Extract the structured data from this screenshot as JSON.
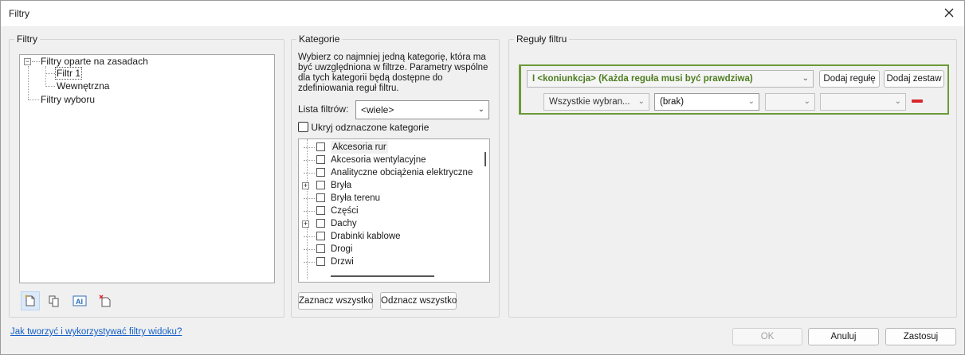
{
  "window": {
    "title": "Filtry"
  },
  "filters_group": {
    "title": "Filtry",
    "tree": {
      "root1": "Filtry oparte na zasadach",
      "child1": "Filtr 1",
      "child2": "Wewnętrzna",
      "root2": "Filtry wyboru"
    },
    "tools": [
      "new-filter-icon",
      "duplicate-filter-icon",
      "rename-filter-icon",
      "delete-filter-icon"
    ]
  },
  "category_group": {
    "title": "Kategorie",
    "description": "Wybierz co najmniej jedną kategorię, która ma być uwzględniona w filtrze. Parametry wspólne dla tych kategorii będą dostępne do zdefiniowania reguł filtru.",
    "filter_list_label": "Lista filtrów:",
    "filter_list_value": "<wiele>",
    "hide_unchecked_label": "Ukryj odznaczone kategorie",
    "categories": [
      {
        "label": "Akcesoria rur",
        "expandable": false
      },
      {
        "label": "Akcesoria wentylacyjne",
        "expandable": false
      },
      {
        "label": "Analityczne obciążenia elektryczne",
        "expandable": false
      },
      {
        "label": "Bryła",
        "expandable": true
      },
      {
        "label": "Bryła terenu",
        "expandable": false
      },
      {
        "label": "Części",
        "expandable": false
      },
      {
        "label": "Dachy",
        "expandable": true
      },
      {
        "label": "Drabinki kablowe",
        "expandable": false
      },
      {
        "label": "Drogi",
        "expandable": false
      },
      {
        "label": "Drzwi",
        "expandable": false
      }
    ],
    "select_all": "Zaznacz wszystko",
    "deselect_all": "Odznacz wszystko"
  },
  "rules_group": {
    "title": "Reguły filtru",
    "conjunction": "I <koniunkcja> (Każda reguła musi być prawdziwa)",
    "add_rule": "Dodaj regułę",
    "add_set": "Dodaj zestaw",
    "rule_param": "Wszystkie wybran...",
    "rule_operator": "(brak)",
    "accent_color": "#4e7d20"
  },
  "footer": {
    "help_link": "Jak tworzyć i wykorzystywać filtry widoku?",
    "ok": "OK",
    "cancel": "Anuluj",
    "apply": "Zastosuj"
  }
}
